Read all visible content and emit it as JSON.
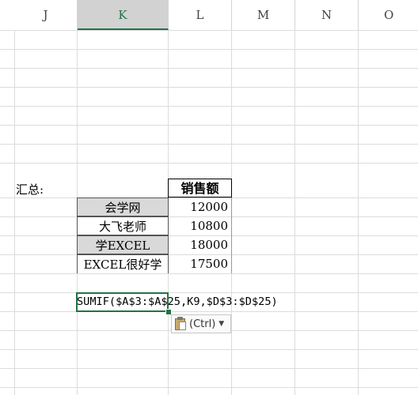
{
  "columns": [
    "J",
    "K",
    "L",
    "M",
    "N",
    "O"
  ],
  "active_column": "K",
  "summary_label": "汇总:",
  "table": {
    "header": "销售额",
    "rows": [
      {
        "name": "会学网",
        "value": "12000"
      },
      {
        "name": "大飞老师",
        "value": "10800"
      },
      {
        "name": "学EXCEL",
        "value": "18000"
      },
      {
        "name": "EXCEL很好学",
        "value": "17500"
      }
    ]
  },
  "formula_text": "SUMIF($A$3:$A$25,K9,$D$3:$D$25)",
  "paste_options": {
    "label": "(Ctrl)",
    "icon": "clipboard-icon",
    "arrow_icon": "chevron-down-icon"
  }
}
